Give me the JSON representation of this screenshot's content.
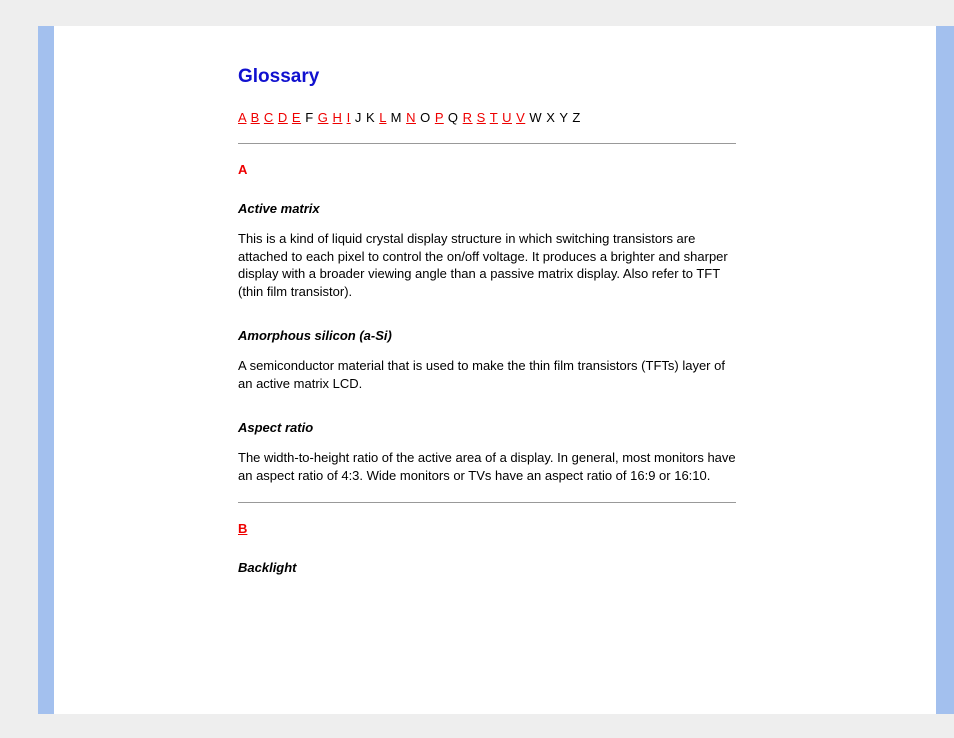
{
  "title": "Glossary",
  "alphabet": [
    {
      "t": "A",
      "link": true
    },
    {
      "t": "B",
      "link": true
    },
    {
      "t": "C",
      "link": true
    },
    {
      "t": "D",
      "link": true
    },
    {
      "t": "E",
      "link": true
    },
    {
      "t": "F",
      "link": false
    },
    {
      "t": "G",
      "link": true
    },
    {
      "t": "H",
      "link": true
    },
    {
      "t": "I",
      "link": true
    },
    {
      "t": "J",
      "link": false
    },
    {
      "t": "K",
      "link": false
    },
    {
      "t": "L",
      "link": true
    },
    {
      "t": "M",
      "link": false
    },
    {
      "t": "N",
      "link": true
    },
    {
      "t": "O",
      "link": false
    },
    {
      "t": "P",
      "link": true
    },
    {
      "t": "Q",
      "link": false
    },
    {
      "t": "R",
      "link": true
    },
    {
      "t": "S",
      "link": true
    },
    {
      "t": "T",
      "link": true
    },
    {
      "t": "U",
      "link": true
    },
    {
      "t": "V",
      "link": true
    },
    {
      "t": "W",
      "link": false
    },
    {
      "t": "X",
      "link": false
    },
    {
      "t": "Y",
      "link": false
    },
    {
      "t": "Z",
      "link": false
    }
  ],
  "sections": {
    "a": {
      "letter": "A",
      "entries": [
        {
          "term": "Active matrix",
          "def": "This is a kind of liquid crystal display structure in which switching transistors are attached to each pixel to control the on/off voltage. It produces a brighter and sharper display with a broader viewing angle than a passive matrix display. Also refer to TFT (thin film transistor)."
        },
        {
          "term": "Amorphous silicon (a-Si)",
          "def": "A semiconductor material that is used to make the thin film transistors (TFTs) layer of an active matrix LCD."
        },
        {
          "term": "Aspect ratio",
          "def": "The width-to-height ratio of the active area of a display. In general, most monitors have an aspect ratio of 4:3. Wide monitors or TVs have an aspect ratio of 16:9 or 16:10."
        }
      ]
    },
    "b": {
      "letter": "B",
      "entries": [
        {
          "term": "Backlight",
          "def": ""
        }
      ]
    }
  }
}
